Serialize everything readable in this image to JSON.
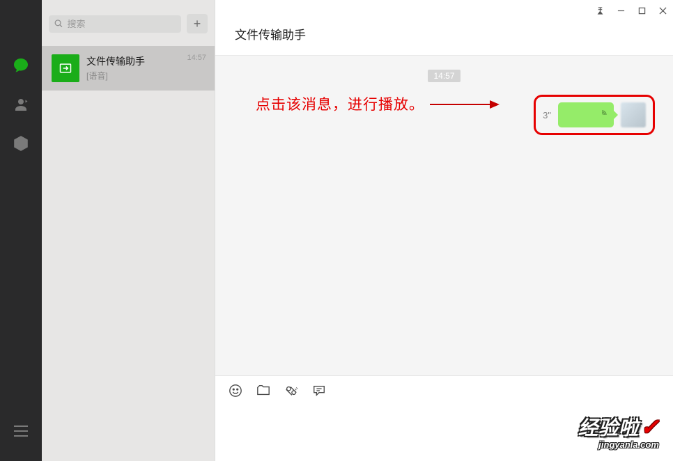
{
  "search": {
    "placeholder": "搜索"
  },
  "conversations": [
    {
      "name": "文件传输助手",
      "preview": "[语音]",
      "time": "14:57"
    }
  ],
  "chat": {
    "title": "文件传输助手",
    "timestamp": "14:57",
    "voice_msg": {
      "duration": "3\""
    }
  },
  "annotation": {
    "text": "点击该消息，进行播放。"
  },
  "watermark": {
    "main": "经验啦",
    "check": "✓",
    "sub": "jingyanla.com"
  }
}
